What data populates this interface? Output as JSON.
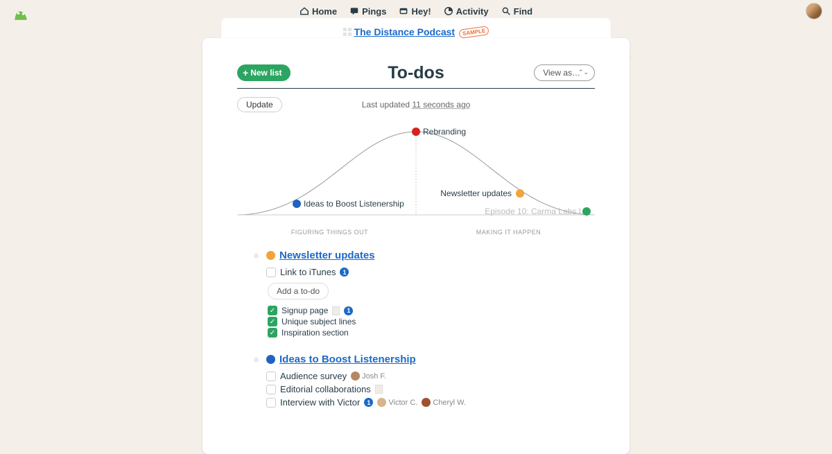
{
  "nav": {
    "home": "Home",
    "pings": "Pings",
    "hey": "Hey!",
    "activity": "Activity",
    "find": "Find"
  },
  "project": {
    "name": "The Distance Podcast",
    "sample": "SAMPLE"
  },
  "page": {
    "title": "To-dos",
    "new_list": "New list",
    "view_as": "View as…",
    "update": "Update",
    "last_updated_prefix": "Last updated ",
    "last_updated_time": "11 seconds ago",
    "add_todo": "Add a to-do"
  },
  "hill": {
    "left_axis": "FIGURING THINGS OUT",
    "right_axis": "MAKING IT HAPPEN",
    "dots": [
      {
        "label": "Ideas to Boost Listenership",
        "color": "#2162c0"
      },
      {
        "label": "Rebranding",
        "color": "#d92020"
      },
      {
        "label": "Newsletter updates",
        "color": "#f2a33c"
      },
      {
        "label": "Episode 10: Carma Labs I",
        "color": "#2da562",
        "faded": true
      }
    ]
  },
  "lists": [
    {
      "color": "#f2a33c",
      "title": "Newsletter updates",
      "open": [
        {
          "text": "Link to iTunes",
          "comments": 1
        }
      ],
      "completed": [
        {
          "text": "Signup page",
          "doc": true,
          "comments": 1
        },
        {
          "text": "Unique subject lines"
        },
        {
          "text": "Inspiration section"
        }
      ]
    },
    {
      "color": "#2162c0",
      "title": "Ideas to Boost Listenership",
      "open": [
        {
          "text": "Audience survey",
          "assignees": [
            {
              "name": "Josh F.",
              "color": "#b58863"
            }
          ]
        },
        {
          "text": "Editorial collaborations",
          "doc": true
        },
        {
          "text": "Interview with Victor",
          "comments": 1,
          "assignees": [
            {
              "name": "Victor C.",
              "color": "#d9b38c"
            },
            {
              "name": "Cheryl W.",
              "color": "#a0522d"
            }
          ]
        }
      ],
      "completed": []
    }
  ]
}
